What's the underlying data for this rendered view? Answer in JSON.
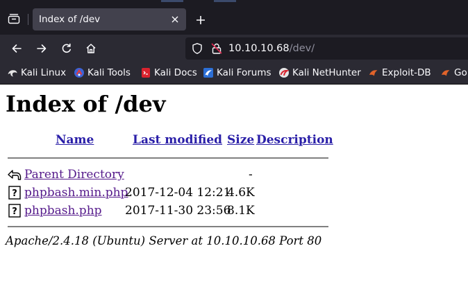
{
  "browser": {
    "tab": {
      "title": "Index of /dev"
    },
    "url": {
      "host": "10.10.10.68",
      "path": "/dev/"
    },
    "bookmarks": [
      {
        "label": "Kali Linux",
        "icon": "kali-dragon-icon"
      },
      {
        "label": "Kali Tools",
        "icon": "kali-tools-icon"
      },
      {
        "label": "Kali Docs",
        "icon": "kali-docs-icon"
      },
      {
        "label": "Kali Forums",
        "icon": "kali-forums-icon"
      },
      {
        "label": "Kali NetHunter",
        "icon": "kali-nethunter-icon"
      },
      {
        "label": "Exploit-DB",
        "icon": "exploit-db-icon"
      },
      {
        "label": "Go",
        "icon": "google-hacking-db-icon"
      }
    ]
  },
  "page": {
    "title": "Index of /dev",
    "columns": {
      "name": "Name",
      "last_modified": "Last modified",
      "size": "Size",
      "description": "Description"
    },
    "rows": [
      {
        "name": "Parent Directory",
        "last_modified": "",
        "size": "-",
        "icon": "back-arrow-icon"
      },
      {
        "name": "phpbash.min.php",
        "last_modified": "2017-12-04 12:21",
        "size": "4.6K",
        "icon": "unknown-file-icon"
      },
      {
        "name": "phpbash.php",
        "last_modified": "2017-11-30 23:56",
        "size": "8.1K",
        "icon": "unknown-file-icon"
      }
    ],
    "footer": "Apache/2.4.18 (Ubuntu) Server at 10.10.10.68 Port 80"
  }
}
